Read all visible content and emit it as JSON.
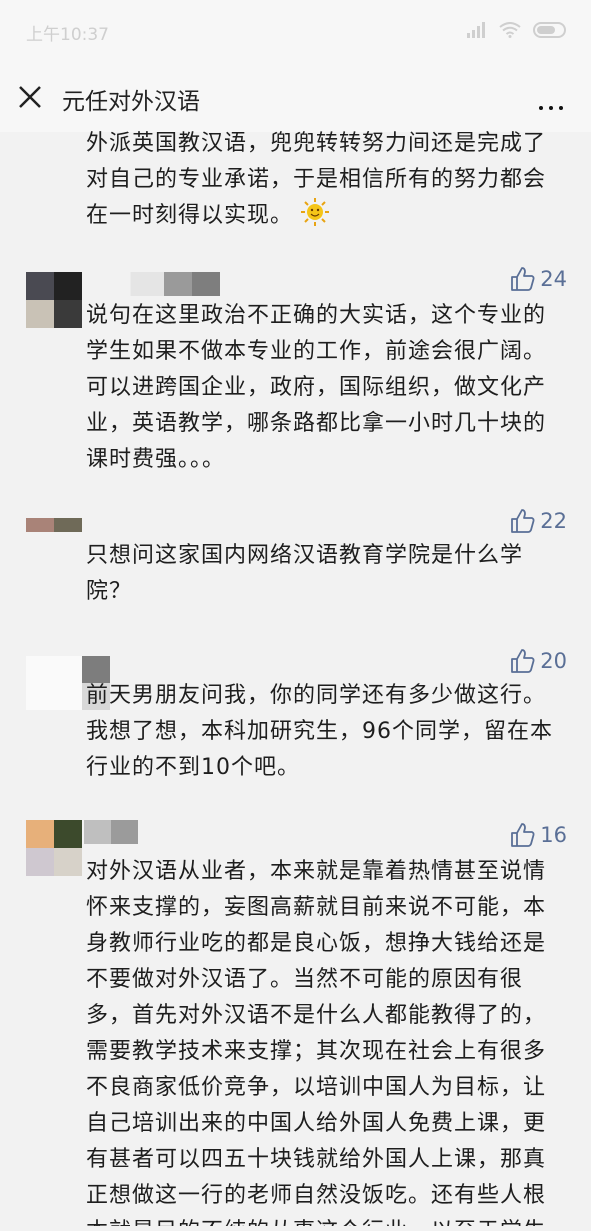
{
  "status": {
    "time": "上午10:37"
  },
  "header": {
    "title": "元任对外汉语"
  },
  "intro": {
    "text": "外派英国教汉语，兜兜转转努力间还是完成了对自己的专业承诺，于是相信所有的努力都会在一时刻得以实现。"
  },
  "comments": [
    {
      "likes": "24",
      "text": "说句在这里政治不正确的大实话，这个专业的学生如果不做本专业的工作，前途会很广阔。可以进跨国企业，政府，国际组织，做文化产业，英语教学，哪条路都比拿一小时几十块的课时费强。。。"
    },
    {
      "likes": "22",
      "text": "只想问这家国内网络汉语教育学院是什么学院？"
    },
    {
      "likes": "20",
      "text": "前天男朋友问我，你的同学还有多少做这行。我想了想，本科加研究生，96个同学，留在本行业的不到10个吧。"
    },
    {
      "likes": "16",
      "text": "对外汉语从业者，本来就是靠着热情甚至说情怀来支撑的，妄图高薪就目前来说不可能，本身教师行业吃的都是良心饭，想挣大钱给还是不要做对外汉语了。当然不可能的原因有很多，首先对外汉语不是什么人都能教得了的，需要教学技术来支撑；其次现在社会上有很多不良商家低价竞争，以培训中国人为目标，让自己培训出来的中国人给外国人免费上课，更有甚者可以四五十块钱就给外国人上课，那真正想做这一行的老师自然没饭吃。还有些人根本就是目的不纯的从事这个行业，以至于学生会问你们是不是约"
    }
  ],
  "colors": {
    "accent": "#5a6f96",
    "background": "#f2f2f2"
  }
}
